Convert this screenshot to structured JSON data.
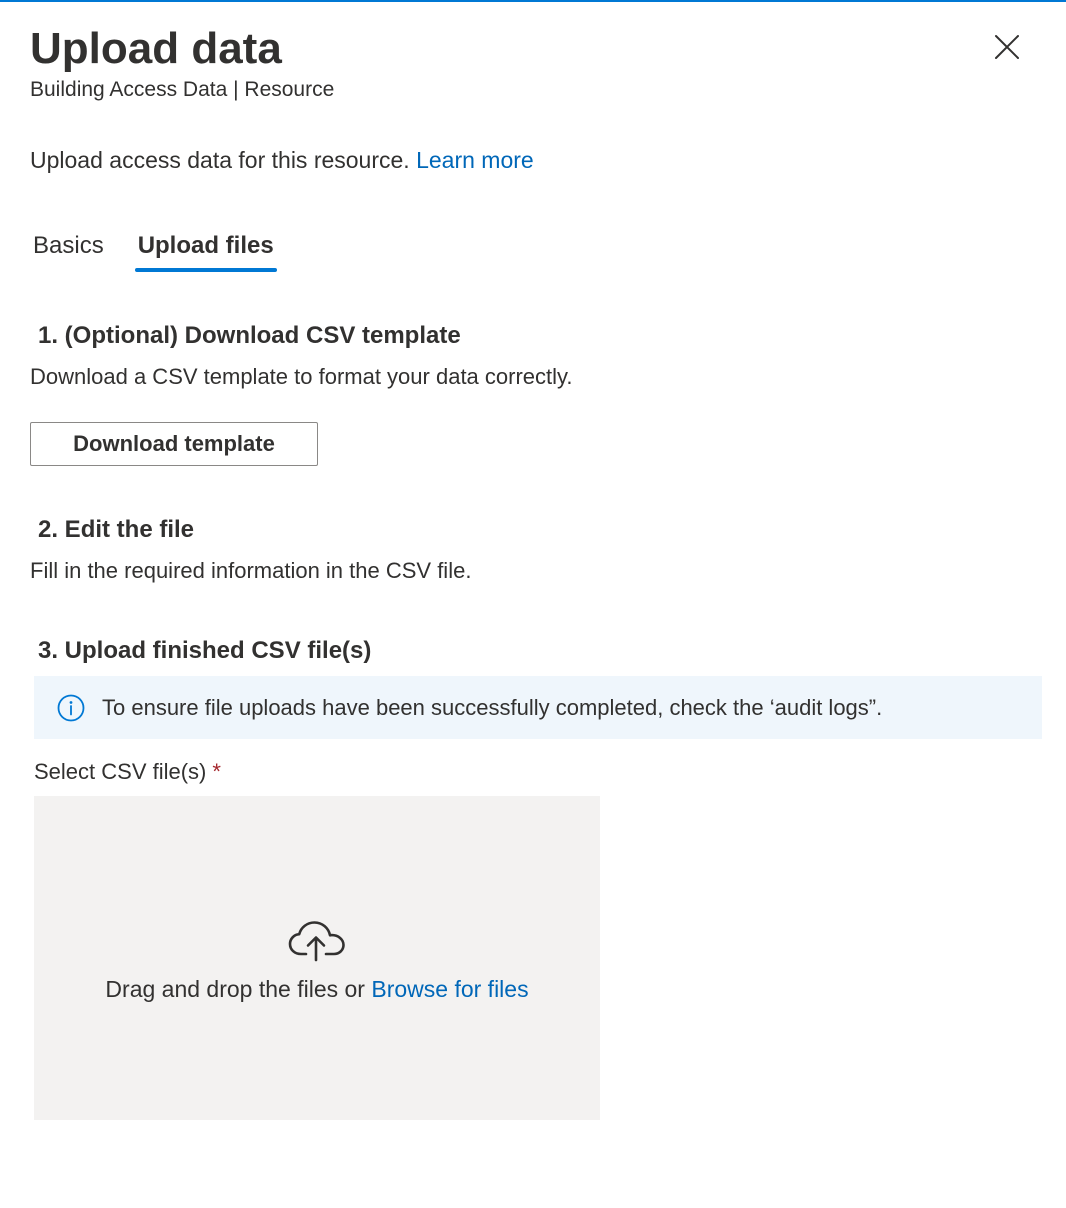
{
  "header": {
    "title": "Upload data",
    "subtitle": "Building Access Data | Resource"
  },
  "intro": {
    "text": "Upload access data for this resource.",
    "link": "Learn more"
  },
  "tabs": [
    {
      "label": "Basics",
      "active": false
    },
    {
      "label": "Upload files",
      "active": true
    }
  ],
  "steps": {
    "step1": {
      "title": "1. (Optional) Download CSV template",
      "description": "Download a CSV template to format your data correctly.",
      "button_label": "Download template"
    },
    "step2": {
      "title": "2. Edit the file",
      "description": "Fill in the required information in the CSV file."
    },
    "step3": {
      "title": "3. Upload finished CSV file(s)"
    }
  },
  "info_banner": {
    "text": "To ensure file uploads have been successfully completed, check the ‘audit logs”."
  },
  "file_field": {
    "label": "Select CSV file(s)",
    "required_marker": "*"
  },
  "dropzone": {
    "text": "Drag and drop the files or",
    "link": "Browse for files"
  },
  "colors": {
    "accent": "#0078d4",
    "link": "#0067b8",
    "info_bg": "#eff6fc",
    "dropzone_bg": "#f3f2f1",
    "required": "#a4262c"
  },
  "icons": {
    "close": "close-icon",
    "info": "info-icon",
    "upload": "cloud-upload-icon"
  }
}
